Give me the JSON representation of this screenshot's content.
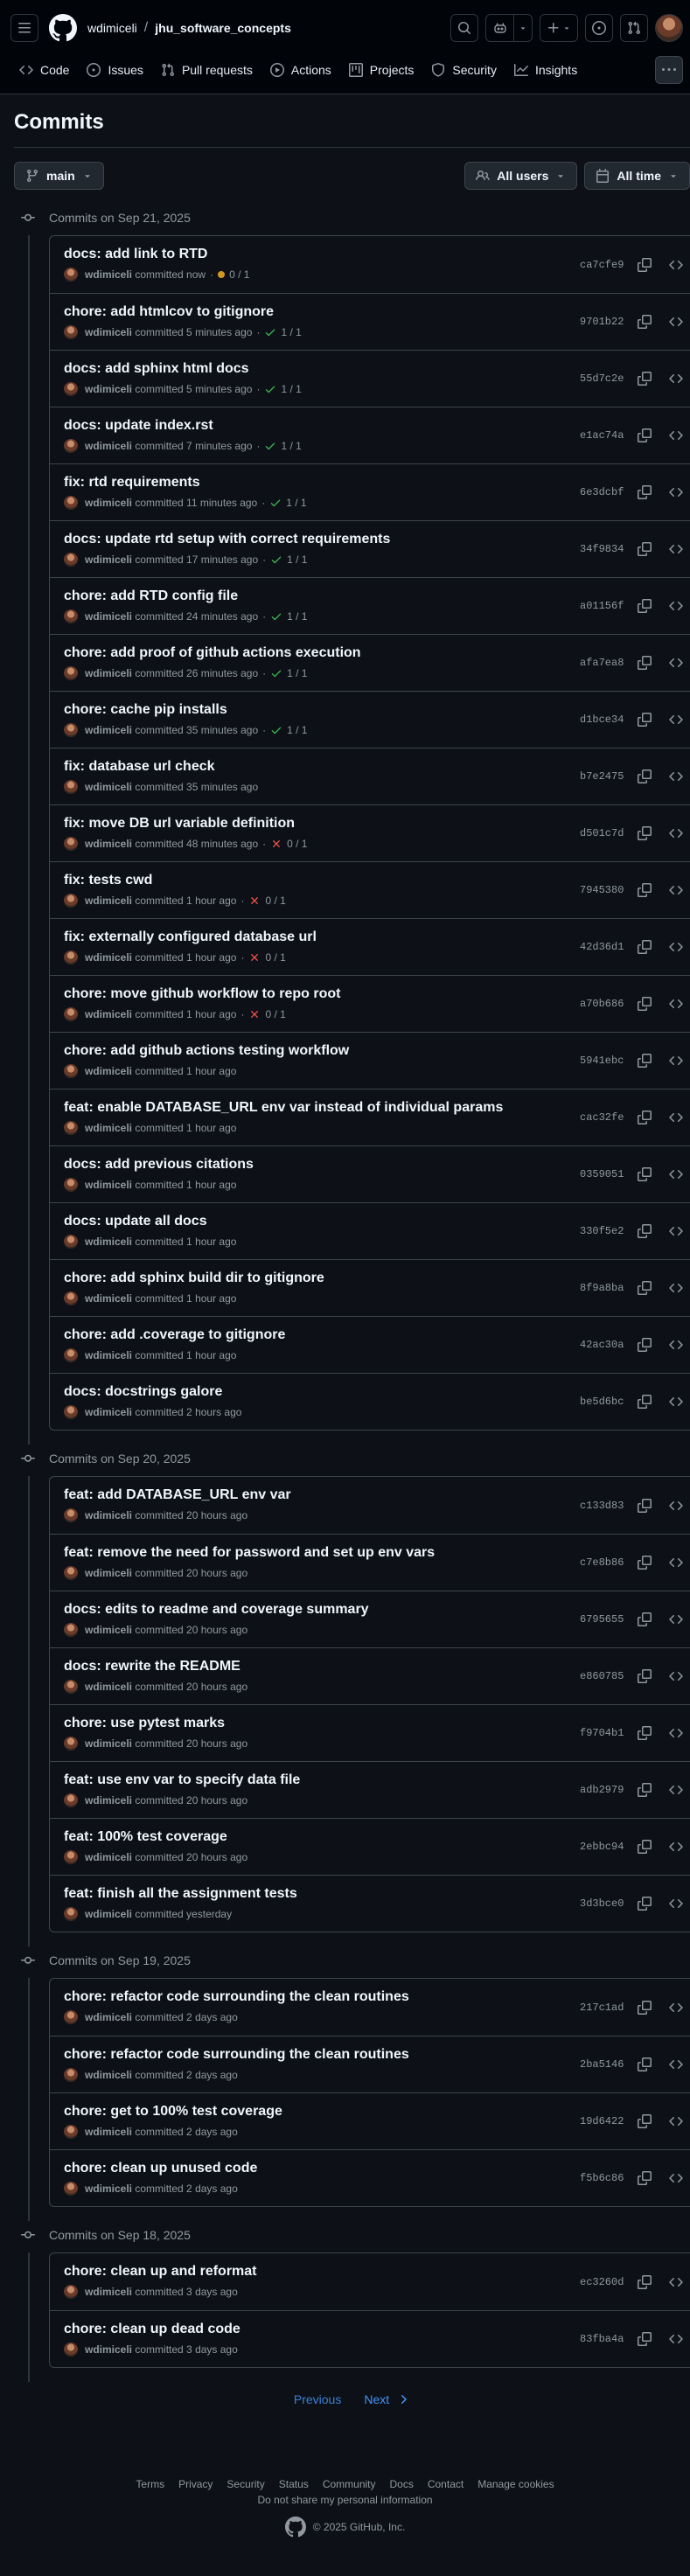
{
  "header": {
    "owner": "wdimiceli",
    "separator": "/",
    "repo": "jhu_software_concepts"
  },
  "nav": [
    {
      "label": "Code",
      "icon": "code-icon"
    },
    {
      "label": "Issues",
      "icon": "issue-icon"
    },
    {
      "label": "Pull requests",
      "icon": "pull-request-icon"
    },
    {
      "label": "Actions",
      "icon": "actions-icon"
    },
    {
      "label": "Projects",
      "icon": "projects-icon"
    },
    {
      "label": "Security",
      "icon": "shield-icon"
    },
    {
      "label": "Insights",
      "icon": "graph-icon"
    }
  ],
  "page": {
    "title": "Commits",
    "branch": "main",
    "users_filter": "All users",
    "time_filter": "All time"
  },
  "groups": [
    {
      "label": "Commits on Sep 21, 2025",
      "commits": [
        {
          "title": "docs: add link to RTD",
          "author": "wdimiceli",
          "time": "committed now",
          "status": "pending",
          "checks": "0 / 1",
          "sha": "ca7cfe9"
        },
        {
          "title": "chore: add htmlcov to gitignore",
          "author": "wdimiceli",
          "time": "committed 5 minutes ago",
          "status": "success",
          "checks": "1 / 1",
          "sha": "9701b22"
        },
        {
          "title": "docs: add sphinx html docs",
          "author": "wdimiceli",
          "time": "committed 5 minutes ago",
          "status": "success",
          "checks": "1 / 1",
          "sha": "55d7c2e"
        },
        {
          "title": "docs: update index.rst",
          "author": "wdimiceli",
          "time": "committed 7 minutes ago",
          "status": "success",
          "checks": "1 / 1",
          "sha": "e1ac74a"
        },
        {
          "title": "fix: rtd requirements",
          "author": "wdimiceli",
          "time": "committed 11 minutes ago",
          "status": "success",
          "checks": "1 / 1",
          "sha": "6e3dcbf"
        },
        {
          "title": "docs: update rtd setup with correct requirements",
          "author": "wdimiceli",
          "time": "committed 17 minutes ago",
          "status": "success",
          "checks": "1 / 1",
          "sha": "34f9834"
        },
        {
          "title": "chore: add RTD config file",
          "author": "wdimiceli",
          "time": "committed 24 minutes ago",
          "status": "success",
          "checks": "1 / 1",
          "sha": "a01156f"
        },
        {
          "title": "chore: add proof of github actions execution",
          "author": "wdimiceli",
          "time": "committed 26 minutes ago",
          "status": "success",
          "checks": "1 / 1",
          "sha": "afa7ea8"
        },
        {
          "title": "chore: cache pip installs",
          "author": "wdimiceli",
          "time": "committed 35 minutes ago",
          "status": "success",
          "checks": "1 / 1",
          "sha": "d1bce34"
        },
        {
          "title": "fix: database url check",
          "author": "wdimiceli",
          "time": "committed 35 minutes ago",
          "status": "",
          "checks": "",
          "sha": "b7e2475"
        },
        {
          "title": "fix: move DB url variable definition",
          "author": "wdimiceli",
          "time": "committed 48 minutes ago",
          "status": "failure",
          "checks": "0 / 1",
          "sha": "d501c7d"
        },
        {
          "title": "fix: tests cwd",
          "author": "wdimiceli",
          "time": "committed 1 hour ago",
          "status": "failure",
          "checks": "0 / 1",
          "sha": "7945380"
        },
        {
          "title": "fix: externally configured database url",
          "author": "wdimiceli",
          "time": "committed 1 hour ago",
          "status": "failure",
          "checks": "0 / 1",
          "sha": "42d36d1"
        },
        {
          "title": "chore: move github workflow to repo root",
          "author": "wdimiceli",
          "time": "committed 1 hour ago",
          "status": "failure",
          "checks": "0 / 1",
          "sha": "a70b686"
        },
        {
          "title": "chore: add github actions testing workflow",
          "author": "wdimiceli",
          "time": "committed 1 hour ago",
          "status": "",
          "checks": "",
          "sha": "5941ebc"
        },
        {
          "title": "feat: enable DATABASE_URL env var instead of individual params",
          "author": "wdimiceli",
          "time": "committed 1 hour ago",
          "status": "",
          "checks": "",
          "sha": "cac32fe"
        },
        {
          "title": "docs: add previous citations",
          "author": "wdimiceli",
          "time": "committed 1 hour ago",
          "status": "",
          "checks": "",
          "sha": "0359051"
        },
        {
          "title": "docs: update all docs",
          "author": "wdimiceli",
          "time": "committed 1 hour ago",
          "status": "",
          "checks": "",
          "sha": "330f5e2"
        },
        {
          "title": "chore: add sphinx build dir to gitignore",
          "author": "wdimiceli",
          "time": "committed 1 hour ago",
          "status": "",
          "checks": "",
          "sha": "8f9a8ba"
        },
        {
          "title": "chore: add .coverage to gitignore",
          "author": "wdimiceli",
          "time": "committed 1 hour ago",
          "status": "",
          "checks": "",
          "sha": "42ac30a"
        },
        {
          "title": "docs: docstrings galore",
          "author": "wdimiceli",
          "time": "committed 2 hours ago",
          "status": "",
          "checks": "",
          "sha": "be5d6bc"
        }
      ]
    },
    {
      "label": "Commits on Sep 20, 2025",
      "commits": [
        {
          "title": "feat: add DATABASE_URL env var",
          "author": "wdimiceli",
          "time": "committed 20 hours ago",
          "status": "",
          "checks": "",
          "sha": "c133d83"
        },
        {
          "title": "feat: remove the need for password and set up env vars",
          "author": "wdimiceli",
          "time": "committed 20 hours ago",
          "status": "",
          "checks": "",
          "sha": "c7e8b86"
        },
        {
          "title": "docs: edits to readme and coverage summary",
          "author": "wdimiceli",
          "time": "committed 20 hours ago",
          "status": "",
          "checks": "",
          "sha": "6795655"
        },
        {
          "title": "docs: rewrite the README",
          "author": "wdimiceli",
          "time": "committed 20 hours ago",
          "status": "",
          "checks": "",
          "sha": "e860785"
        },
        {
          "title": "chore: use pytest marks",
          "author": "wdimiceli",
          "time": "committed 20 hours ago",
          "status": "",
          "checks": "",
          "sha": "f9704b1"
        },
        {
          "title": "feat: use env var to specify data file",
          "author": "wdimiceli",
          "time": "committed 20 hours ago",
          "status": "",
          "checks": "",
          "sha": "adb2979"
        },
        {
          "title": "feat: 100% test coverage",
          "author": "wdimiceli",
          "time": "committed 20 hours ago",
          "status": "",
          "checks": "",
          "sha": "2ebbc94"
        },
        {
          "title": "feat: finish all the assignment tests",
          "author": "wdimiceli",
          "time": "committed yesterday",
          "status": "",
          "checks": "",
          "sha": "3d3bce0"
        }
      ]
    },
    {
      "label": "Commits on Sep 19, 2025",
      "commits": [
        {
          "title": "chore: refactor code surrounding the clean routines",
          "author": "wdimiceli",
          "time": "committed 2 days ago",
          "status": "",
          "checks": "",
          "sha": "217c1ad"
        },
        {
          "title": "chore: refactor code surrounding the clean routines",
          "author": "wdimiceli",
          "time": "committed 2 days ago",
          "status": "",
          "checks": "",
          "sha": "2ba5146"
        },
        {
          "title": "chore: get to 100% test coverage",
          "author": "wdimiceli",
          "time": "committed 2 days ago",
          "status": "",
          "checks": "",
          "sha": "19d6422"
        },
        {
          "title": "chore: clean up unused code",
          "author": "wdimiceli",
          "time": "committed 2 days ago",
          "status": "",
          "checks": "",
          "sha": "f5b6c86"
        }
      ]
    },
    {
      "label": "Commits on Sep 18, 2025",
      "commits": [
        {
          "title": "chore: clean up and reformat",
          "author": "wdimiceli",
          "time": "committed 3 days ago",
          "status": "",
          "checks": "",
          "sha": "ec3260d"
        },
        {
          "title": "chore: clean up dead code",
          "author": "wdimiceli",
          "time": "committed 3 days ago",
          "status": "",
          "checks": "",
          "sha": "83fba4a"
        }
      ]
    }
  ],
  "pagination": {
    "previous": "Previous",
    "next": "Next"
  },
  "footer": {
    "links": [
      "Terms",
      "Privacy",
      "Security",
      "Status",
      "Community",
      "Docs",
      "Contact",
      "Manage cookies"
    ],
    "privacy": "Do not share my personal information",
    "copyright": "© 2025 GitHub, Inc."
  },
  "colors": {
    "background": "#0d1117",
    "success": "#3fb950",
    "failure": "#f85149",
    "pending": "#d29922",
    "link": "#4493f8",
    "nav_underline": "#f78166"
  }
}
